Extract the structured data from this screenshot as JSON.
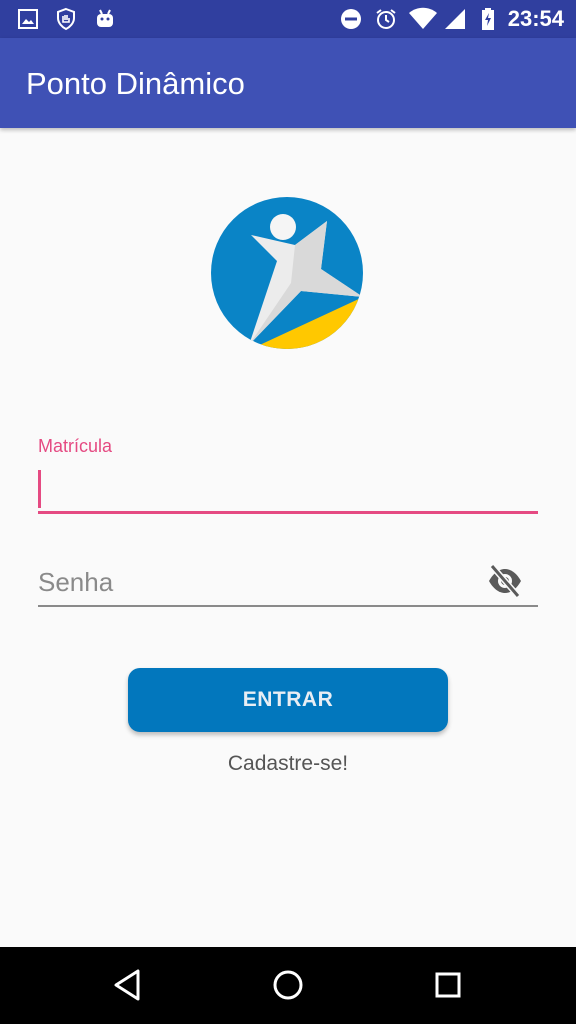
{
  "status_bar": {
    "time": "23:54",
    "icons": [
      "image-icon",
      "shield-hand-icon",
      "android-icon",
      "do-not-disturb-icon",
      "alarm-icon",
      "wifi-icon",
      "signal-icon",
      "battery-charging-icon"
    ]
  },
  "app_bar": {
    "title": "Ponto Dinâmico"
  },
  "form": {
    "matricula_label": "Matrícula",
    "matricula_value": "",
    "senha_placeholder": "Senha",
    "senha_value": "",
    "visibility_icon": "visibility-off-icon"
  },
  "actions": {
    "entrar_label": "ENTRAR",
    "cadastre_label": "Cadastre-se!"
  },
  "colors": {
    "status_bar": "#303f9f",
    "app_bar": "#3f51b5",
    "accent": "#e54a82",
    "button": "#0277bd",
    "logo_blue": "#0a84c6",
    "logo_yellow": "#ffc800"
  },
  "nav_bar": {
    "buttons": [
      "back-icon",
      "home-icon",
      "recents-icon"
    ]
  }
}
